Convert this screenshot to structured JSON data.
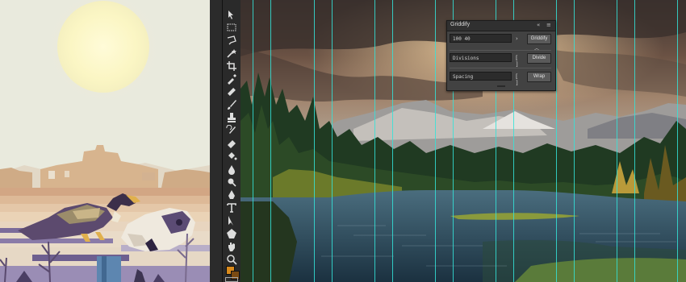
{
  "panel": {
    "title": "Griddify",
    "collapse_icon": "«",
    "menu_icon": "≡",
    "grid_value": "100 40",
    "arrow_icon": "›",
    "griddify_label": "Griddify",
    "divisions_placeholder": "Divisions",
    "divide_label": "Divide",
    "spacing_placeholder": "Spacing",
    "wrap_label": "Wrap",
    "toggle_icon": "[ ]"
  },
  "toolbar": {
    "tools": [
      "move-tool",
      "marquee-tool",
      "lasso-tool",
      "quick-select-tool",
      "crop-tool",
      "eyedropper-tool",
      "healing-brush-tool",
      "brush-tool",
      "clone-stamp-tool",
      "history-brush-tool",
      "eraser-tool",
      "gradient-tool",
      "blur-tool",
      "dodge-tool",
      "pen-tool",
      "type-tool",
      "path-select-tool",
      "shape-tool",
      "hand-tool",
      "zoom-tool"
    ]
  },
  "colors": {
    "guide": "#34e3d8",
    "foreground": "#d98a1c",
    "background": "#7a4a12"
  }
}
